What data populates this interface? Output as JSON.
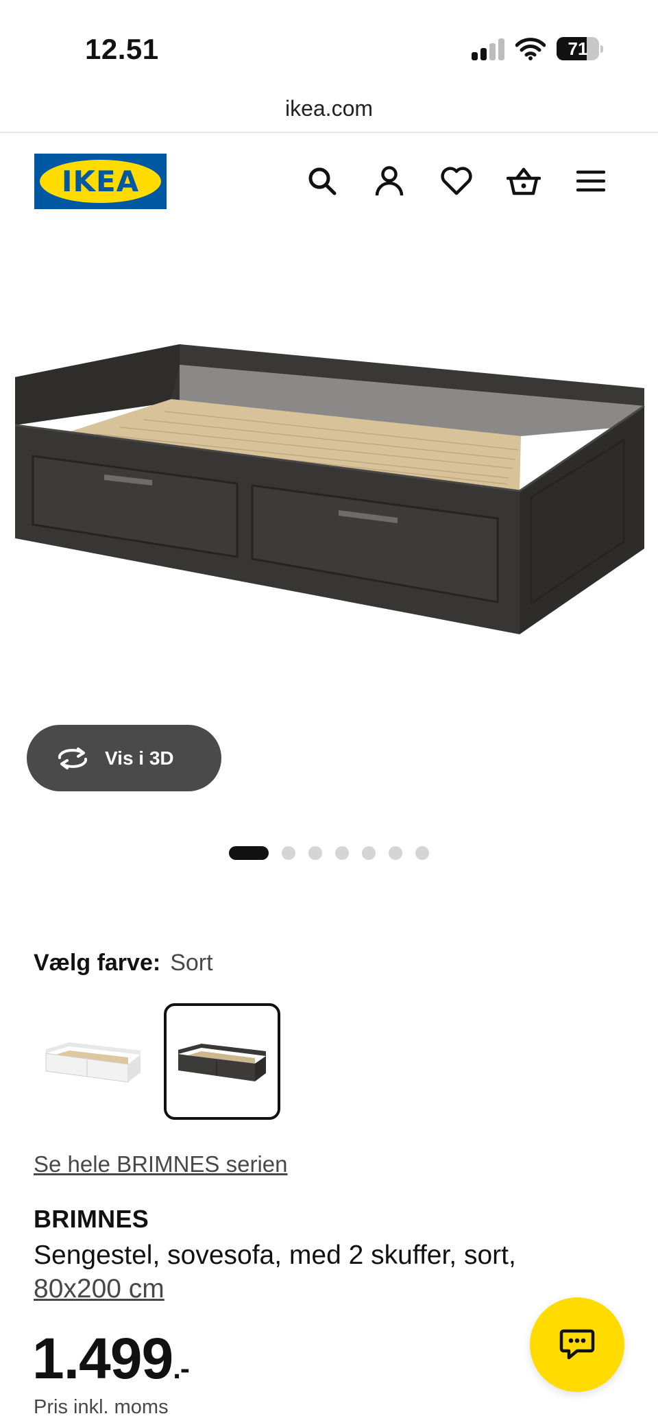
{
  "status_bar": {
    "time": "12.51",
    "battery_percent": "71",
    "battery_level": 0.71,
    "signal_bars_active": 2,
    "signal_bars_total": 4
  },
  "browser": {
    "url": "ikea.com"
  },
  "header": {
    "logo_text": "IKEA",
    "icons": [
      "search-icon",
      "account-icon",
      "heart-icon",
      "cart-icon",
      "menu-icon"
    ]
  },
  "gallery": {
    "view_3d_label": "Vis i 3D",
    "image_count": 7,
    "active_index": 0
  },
  "color": {
    "label": "Vælg farve:",
    "value": "Sort",
    "options": [
      "white",
      "black"
    ],
    "selected_index": 1
  },
  "product": {
    "series_link": "Se hele BRIMNES serien",
    "name": "BRIMNES",
    "description": "Sengestel, sovesofa, med 2 skuffer, sort,",
    "size": "80x200 cm",
    "price": "1.499",
    "price_suffix": ".-",
    "price_note": "Pris inkl. moms"
  },
  "colors": {
    "ikea_blue": "#0058a3",
    "ikea_yellow": "#ffdb00",
    "button_dark": "#4a4a4a",
    "text_secondary": "#484848"
  }
}
